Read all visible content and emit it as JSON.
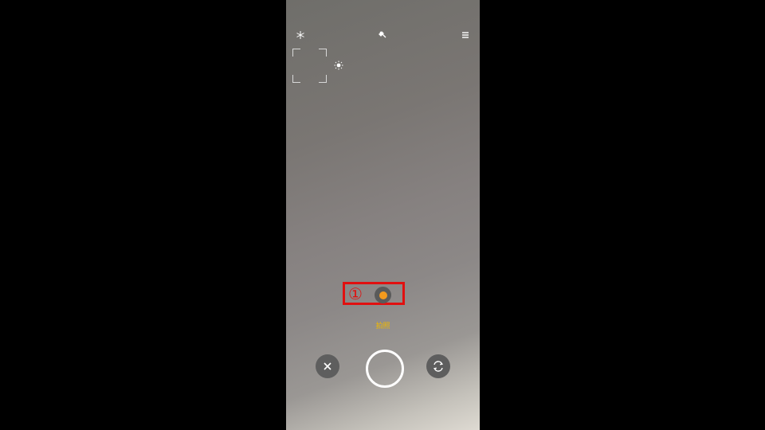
{
  "camera": {
    "top_bar": {
      "left_icon": "flash-icon",
      "center_icon": "effects-icon",
      "right_icon": "menu-icon"
    },
    "exposure_icon": "brightness-icon",
    "annotation": {
      "step_label": "①",
      "color": "#e11010"
    },
    "mode": {
      "label": "拍照",
      "accent": "#f39a1e",
      "label_color": "#f0b800"
    },
    "controls": {
      "close_icon": "close-icon",
      "shutter_icon": "shutter-button",
      "switch_icon": "switch-camera-icon"
    }
  }
}
